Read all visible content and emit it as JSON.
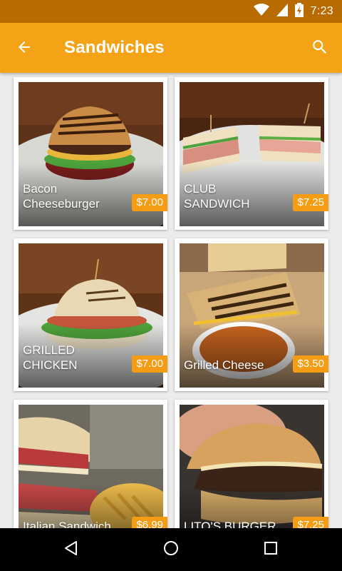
{
  "status_bar": {
    "time": "7:23"
  },
  "app_bar": {
    "title": "Sandwiches"
  },
  "colors": {
    "status_bar": "#b76b00",
    "app_bar": "#f4a316",
    "price_badge": "#f49c14",
    "nav_bar": "#000000"
  },
  "icons": {
    "back": "arrow-back-icon",
    "search": "search-icon",
    "wifi": "wifi-icon",
    "signal": "cell-signal-icon",
    "battery": "battery-charging-icon",
    "nav_back": "nav-back-icon",
    "nav_home": "nav-home-icon",
    "nav_recents": "nav-recents-icon"
  },
  "items": [
    {
      "name": "Bacon Cheeseburger",
      "price": "$7.00"
    },
    {
      "name": "CLUB SANDWICH",
      "price": "$7.25"
    },
    {
      "name": "GRILLED CHICKEN",
      "price": "$7.00"
    },
    {
      "name": "Grilled Cheese",
      "price": "$3.50"
    },
    {
      "name": "Italian Sandwich",
      "price": "$6.99"
    },
    {
      "name": "LITO'S BURGER",
      "price": "$7.25"
    }
  ]
}
